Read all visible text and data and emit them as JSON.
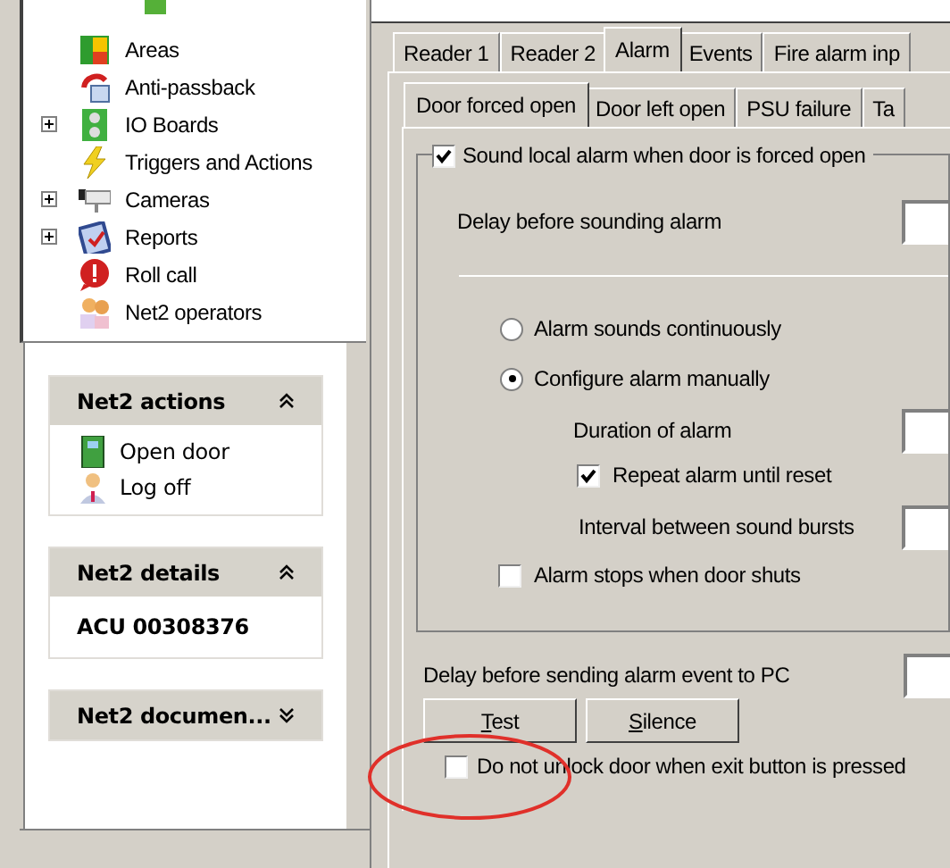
{
  "tree": {
    "items": [
      {
        "label": "Areas",
        "kind": "areas",
        "expandable": false
      },
      {
        "label": "Anti-passback",
        "kind": "anti-passback",
        "expandable": false
      },
      {
        "label": "IO Boards",
        "kind": "io-boards",
        "expandable": true
      },
      {
        "label": "Triggers and Actions",
        "kind": "triggers",
        "expandable": false
      },
      {
        "label": "Cameras",
        "kind": "cameras",
        "expandable": true
      },
      {
        "label": "Reports",
        "kind": "reports",
        "expandable": true
      },
      {
        "label": "Roll call",
        "kind": "roll-call",
        "expandable": false
      },
      {
        "label": "Net2 operators",
        "kind": "operators",
        "expandable": false
      }
    ]
  },
  "panels": [
    {
      "title": "Net2 actions",
      "expanded": true,
      "items": [
        {
          "label": "Open door",
          "kind": "door"
        },
        {
          "label": "Log off",
          "kind": "user"
        }
      ]
    },
    {
      "title": "Net2 details",
      "expanded": true,
      "value": "ACU 00308376"
    },
    {
      "title": "Net2 documen...",
      "expanded": false
    }
  ],
  "tabs": [
    {
      "label": "Reader 1",
      "selected": false
    },
    {
      "label": "Reader 2",
      "selected": false
    },
    {
      "label": "Alarm",
      "selected": true
    },
    {
      "label": "Events",
      "selected": false
    },
    {
      "label": "Fire alarm inp",
      "selected": false
    }
  ],
  "subtabs": [
    {
      "label": "Door forced open",
      "selected": true
    },
    {
      "label": "Door left open",
      "selected": false
    },
    {
      "label": "PSU failure",
      "selected": false
    },
    {
      "label": "Ta",
      "selected": false
    }
  ],
  "sound_alarm": {
    "label": "Sound local alarm when door is forced open",
    "checked": true
  },
  "delay_sounding": {
    "label": "Delay before sounding alarm"
  },
  "radios": [
    {
      "label": "Alarm sounds continuously",
      "selected": false
    },
    {
      "label": "Configure alarm manually",
      "selected": true
    }
  ],
  "duration": {
    "label": "Duration of alarm"
  },
  "repeat": {
    "label": "Repeat alarm until reset",
    "checked": true
  },
  "interval": {
    "label": "Interval between sound bursts"
  },
  "stops_when_shut": {
    "label": "Alarm stops when door shuts",
    "checked": false
  },
  "delay_pc": {
    "label": "Delay before sending alarm event to PC"
  },
  "buttons": [
    "Test",
    "Silence"
  ],
  "exit_button": {
    "label": "Do not unlock door when exit button is pressed",
    "checked": false
  }
}
